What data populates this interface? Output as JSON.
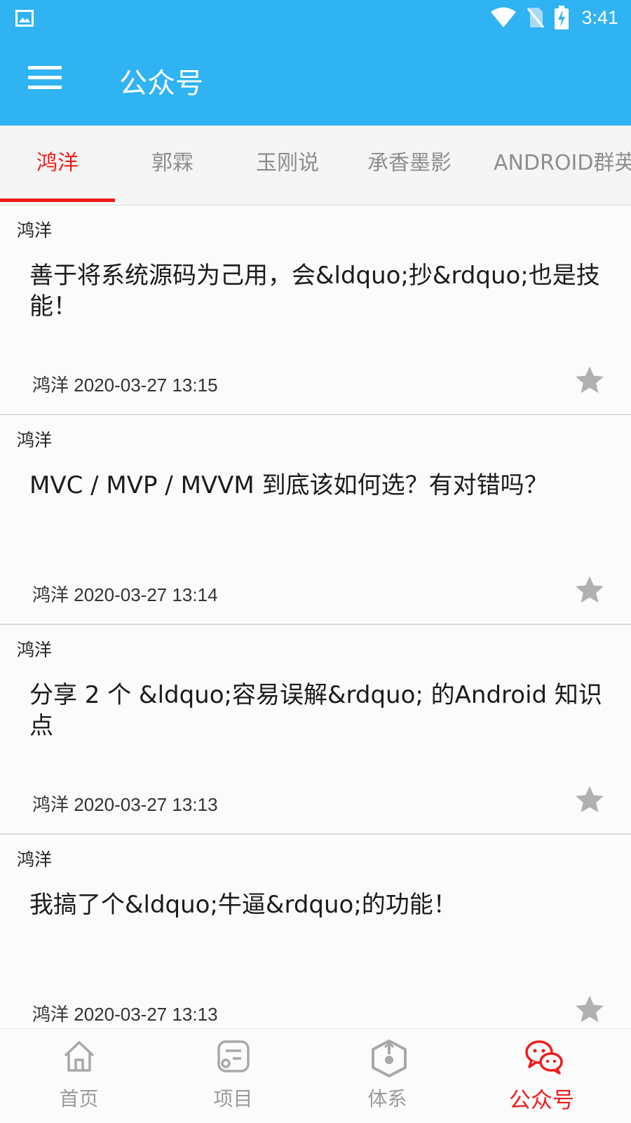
{
  "status_bar": {
    "time": "3:41",
    "icons": [
      "image-icon",
      "wifi-icon",
      "no-sim-icon",
      "battery-charging-icon"
    ]
  },
  "appbar": {
    "title": "公众号",
    "menu_icon": "hamburger-menu-icon"
  },
  "tabs": [
    {
      "label": "鸿洋",
      "active": true
    },
    {
      "label": "郭霖",
      "active": false
    },
    {
      "label": "玉刚说",
      "active": false
    },
    {
      "label": "承香墨影",
      "active": false
    },
    {
      "label": "ANDROID群英传",
      "active": false
    }
  ],
  "articles": [
    {
      "author": "鸿洋",
      "title": "善于将系统源码为己用，会&ldquo;抄&rdquo;也是技能！",
      "meta_author": "鸿洋",
      "date": "2020-03-27 13:15",
      "starred": false
    },
    {
      "author": "鸿洋",
      "title": "MVC / MVP / MVVM 到底该如何选？有对错吗？",
      "meta_author": "鸿洋",
      "date": "2020-03-27 13:14",
      "starred": false
    },
    {
      "author": "鸿洋",
      "title": "分享 2 个 &ldquo;容易误解&rdquo; 的Android 知识点",
      "meta_author": "鸿洋",
      "date": "2020-03-27 13:13",
      "starred": false
    },
    {
      "author": "鸿洋",
      "title": "我搞了个&ldquo;牛逼&rdquo;的功能！",
      "meta_author": "鸿洋",
      "date": "2020-03-27 13:13",
      "starred": false
    }
  ],
  "bottom_nav": [
    {
      "label": "首页",
      "icon": "home-icon",
      "active": false
    },
    {
      "label": "项目",
      "icon": "project-list-icon",
      "active": false
    },
    {
      "label": "体系",
      "icon": "system-hexagon-icon",
      "active": false
    },
    {
      "label": "公众号",
      "icon": "wechat-icon",
      "active": true
    }
  ],
  "colors": {
    "primary": "#2fb3f2",
    "accent": "#ee1c1c",
    "inactive_text": "#8e8e8e",
    "star_gray": "#b0b0b0"
  }
}
